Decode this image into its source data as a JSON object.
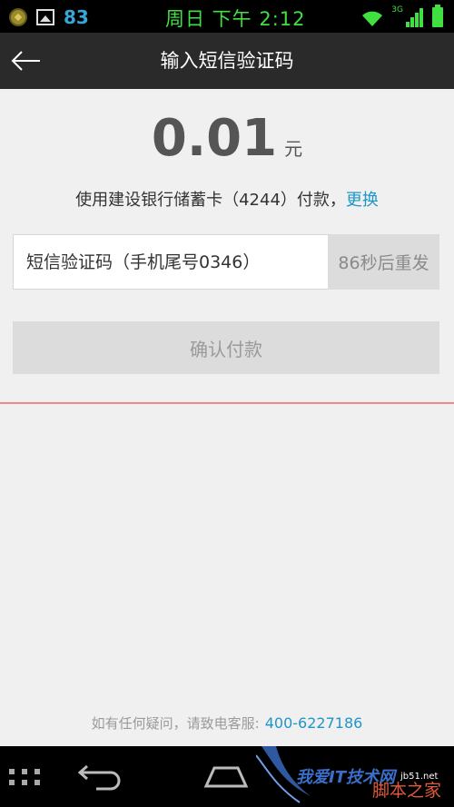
{
  "status_bar": {
    "notification_count": "83",
    "time": "周日 下午 2:12",
    "network_type": "3G",
    "icons": [
      "coin-icon",
      "image-icon",
      "wifi-icon",
      "signal-icon",
      "battery-icon"
    ]
  },
  "header": {
    "title": "输入短信验证码",
    "back_icon": "arrow-left-icon"
  },
  "payment": {
    "amount": "0.01",
    "unit": "元",
    "card_text": "使用建设银行储蓄卡（4244）付款，",
    "change_label": "更换"
  },
  "sms": {
    "placeholder": "短信验证码（手机尾号0346）",
    "value": "",
    "resend_label": "86秒后重发"
  },
  "confirm_label": "确认付款",
  "support": {
    "text": "如有任何疑问，请致电客服:",
    "phone": "400-6227186"
  },
  "watermark": {
    "text": "我爱IT技术网",
    "text2": "脚本之家",
    "small": "jb51.net"
  },
  "colors": {
    "link": "#2096c8",
    "status_green": "#3fe03f",
    "divider": "#e98b8b",
    "title_bar": "#2a2a2a"
  }
}
